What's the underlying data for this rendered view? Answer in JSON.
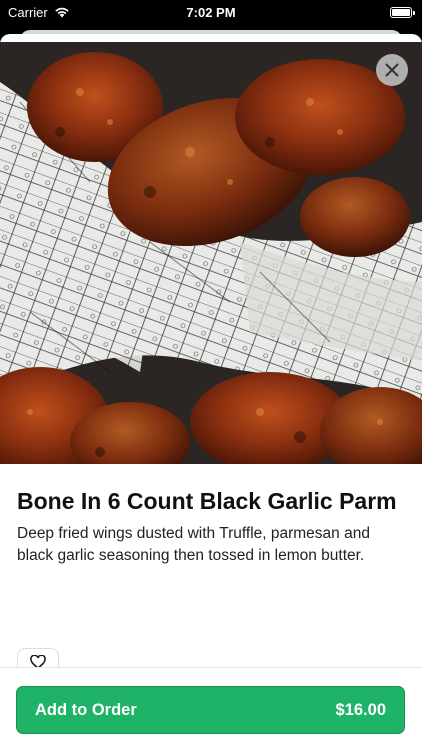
{
  "status_bar": {
    "carrier": "Carrier",
    "time": "7:02 PM",
    "icons": [
      "wifi-icon",
      "battery-icon"
    ]
  },
  "item": {
    "title": "Bone In 6 Count Black Garlic Parm",
    "description": "Deep fried wings dusted with Truffle, parmesan and black garlic seasoning then tossed in lemon butter.",
    "image_icon": "food-photo"
  },
  "actions": {
    "close_icon": "close-icon",
    "favorite_icon": "heart-icon",
    "add_label": "Add to Order",
    "price": "$16.00"
  },
  "colors": {
    "accent": "#1fb368",
    "close_bg": "#bebebe"
  }
}
